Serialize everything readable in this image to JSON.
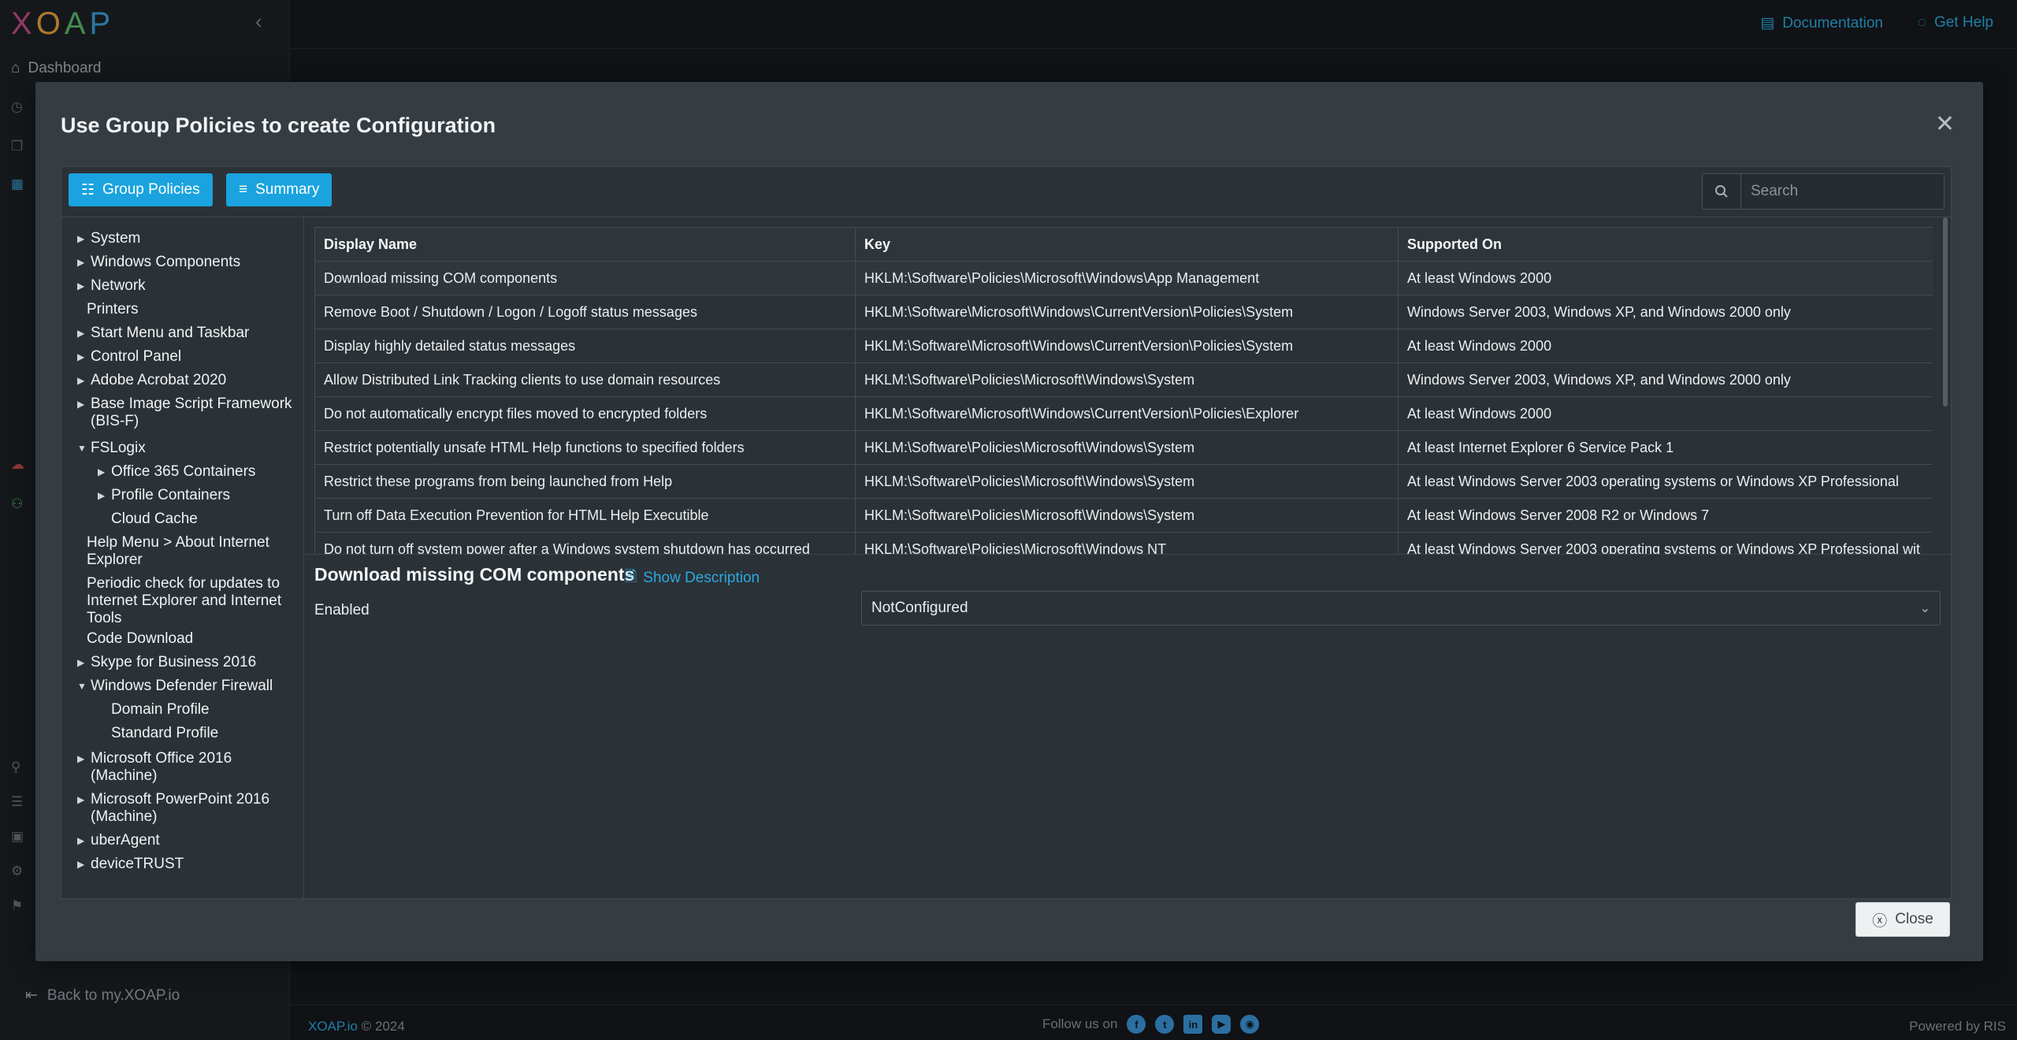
{
  "app": {
    "logo": [
      "X",
      "O",
      "A",
      "P"
    ],
    "nav_dashboard": "Dashboard",
    "back_link": "Back to my.XOAP.io",
    "top_links": {
      "documentation": "Documentation",
      "get_help": "Get Help"
    },
    "footer": {
      "brand": "XOAP.io",
      "copyright": "© 2024",
      "follow": "Follow us on",
      "powered": "Powered by RIS"
    }
  },
  "modal": {
    "title": "Use Group Policies to create Configuration",
    "toolbar": {
      "group_policies": "Group Policies",
      "summary": "Summary",
      "search_placeholder": "Search"
    },
    "tree": [
      {
        "label": "System",
        "arrow": true,
        "level": 0
      },
      {
        "label": "Windows Components",
        "arrow": true,
        "level": 0
      },
      {
        "label": "Network",
        "arrow": true,
        "level": 0
      },
      {
        "label": "Printers",
        "arrow": false,
        "level": 0
      },
      {
        "label": "Start Menu and Taskbar",
        "arrow": true,
        "level": 0
      },
      {
        "label": "Control Panel",
        "arrow": true,
        "level": 0
      },
      {
        "label": "Adobe Acrobat 2020",
        "arrow": true,
        "level": 0
      },
      {
        "label": "Base Image Script Framework\n(BIS-F)",
        "arrow": true,
        "level": 0
      },
      {
        "label": "FSLogix",
        "arrow": "down",
        "level": 0
      },
      {
        "label": "Office 365 Containers",
        "arrow": true,
        "level": 1
      },
      {
        "label": "Profile Containers",
        "arrow": true,
        "level": 1
      },
      {
        "label": "Cloud Cache",
        "arrow": false,
        "level": 1
      },
      {
        "label": "Help Menu > About Internet\nExplorer",
        "arrow": false,
        "level": 0
      },
      {
        "label": "Periodic check for updates to\nInternet Explorer and Internet\nTools",
        "arrow": false,
        "level": 0
      },
      {
        "label": "Code Download",
        "arrow": false,
        "level": 0
      },
      {
        "label": "Skype for Business 2016",
        "arrow": true,
        "level": 0
      },
      {
        "label": "Windows Defender Firewall",
        "arrow": "down",
        "level": 0
      },
      {
        "label": "Domain Profile",
        "arrow": false,
        "level": 1
      },
      {
        "label": "Standard Profile",
        "arrow": false,
        "level": 1
      },
      {
        "label": "Microsoft Office 2016\n(Machine)",
        "arrow": true,
        "level": 0
      },
      {
        "label": "Microsoft PowerPoint 2016\n(Machine)",
        "arrow": true,
        "level": 0
      },
      {
        "label": "uberAgent",
        "arrow": true,
        "level": 0
      },
      {
        "label": "deviceTRUST",
        "arrow": true,
        "level": 0
      }
    ],
    "table": {
      "headers": [
        "Display Name",
        "Key",
        "Supported On"
      ],
      "rows": [
        [
          "Download missing COM components",
          "HKLM:\\Software\\Policies\\Microsoft\\Windows\\App Management",
          "At least Windows 2000"
        ],
        [
          "Remove Boot / Shutdown / Logon / Logoff status messages",
          "HKLM:\\Software\\Microsoft\\Windows\\CurrentVersion\\Policies\\System",
          "Windows Server 2003, Windows XP, and Windows 2000 only"
        ],
        [
          "Display highly detailed status messages",
          "HKLM:\\Software\\Microsoft\\Windows\\CurrentVersion\\Policies\\System",
          "At least Windows 2000"
        ],
        [
          "Allow Distributed Link Tracking clients to use domain resources",
          "HKLM:\\Software\\Policies\\Microsoft\\Windows\\System",
          "Windows Server 2003, Windows XP, and Windows 2000 only"
        ],
        [
          "Do not automatically encrypt files moved to encrypted folders",
          "HKLM:\\Software\\Microsoft\\Windows\\CurrentVersion\\Policies\\Explorer",
          "At least Windows 2000"
        ],
        [
          "Restrict potentially unsafe HTML Help functions to specified folders",
          "HKLM:\\Software\\Policies\\Microsoft\\Windows\\System",
          "At least Internet Explorer 6 Service Pack 1"
        ],
        [
          "Restrict these programs from being launched from Help",
          "HKLM:\\Software\\Policies\\Microsoft\\Windows\\System",
          "At least Windows Server 2003 operating systems or Windows XP Professional"
        ],
        [
          "Turn off Data Execution Prevention for HTML Help Executible",
          "HKLM:\\Software\\Policies\\Microsoft\\Windows\\System",
          "At least Windows Server 2008 R2 or Windows 7"
        ],
        [
          "Do not turn off system power after a Windows system shutdown has occurred",
          "HKLM:\\Software\\Policies\\Microsoft\\Windows NT",
          "At least Windows Server 2003 operating systems or Windows XP Professional wit"
        ]
      ]
    },
    "detail": {
      "title": "Download missing COM components",
      "show_description": "Show Description",
      "field_label": "Enabled",
      "field_value": "NotConfigured"
    },
    "close_label": "Close"
  }
}
